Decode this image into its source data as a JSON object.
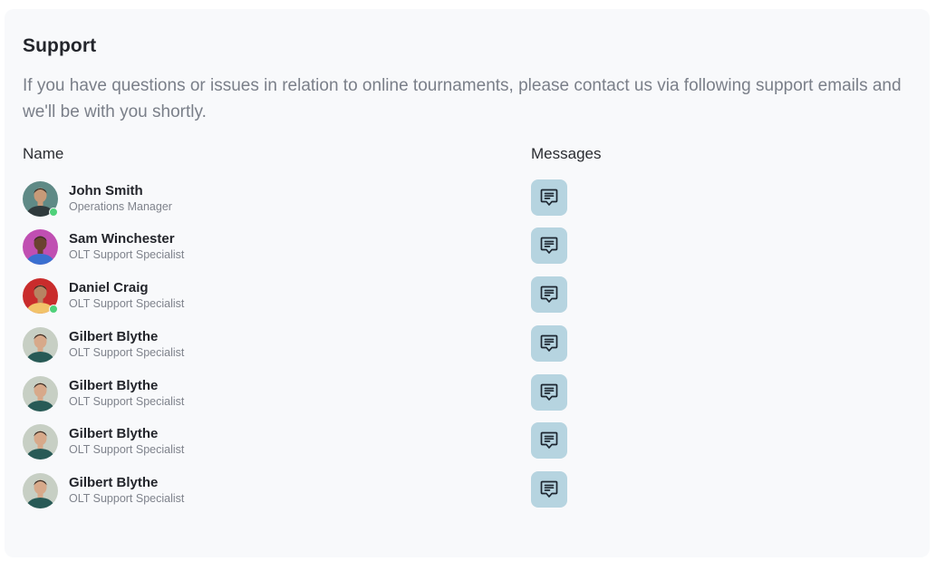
{
  "support": {
    "title": "Support",
    "description": "If you have questions or issues in relation to online tournaments, please contact us via following support emails and we'll be with you shortly.",
    "columns": {
      "name": "Name",
      "messages": "Messages"
    },
    "contacts": [
      {
        "name": "John Smith",
        "role": "Operations Manager",
        "online": true,
        "avatar_bg": "#5f8a86",
        "avatar_skin": "#c79a78",
        "avatar_shirt": "#2f3a3c"
      },
      {
        "name": "Sam Winchester",
        "role": "OLT Support Specialist",
        "online": false,
        "avatar_bg": "#c04fb2",
        "avatar_skin": "#6a4230",
        "avatar_shirt": "#3a6fd0"
      },
      {
        "name": "Daniel Craig",
        "role": "OLT Support Specialist",
        "online": true,
        "avatar_bg": "#c92c2c",
        "avatar_skin": "#b78462",
        "avatar_shirt": "#f2c36a"
      },
      {
        "name": "Gilbert Blythe",
        "role": "OLT Support Specialist",
        "online": false,
        "avatar_bg": "#c7cfc4",
        "avatar_skin": "#d7a98a",
        "avatar_shirt": "#285a56"
      },
      {
        "name": "Gilbert Blythe",
        "role": "OLT Support Specialist",
        "online": false,
        "avatar_bg": "#c7cfc4",
        "avatar_skin": "#d7a98a",
        "avatar_shirt": "#285a56"
      },
      {
        "name": "Gilbert Blythe",
        "role": "OLT Support Specialist",
        "online": false,
        "avatar_bg": "#c7cfc4",
        "avatar_skin": "#d7a98a",
        "avatar_shirt": "#285a56"
      },
      {
        "name": "Gilbert Blythe",
        "role": "OLT Support Specialist",
        "online": false,
        "avatar_bg": "#c7cfc4",
        "avatar_skin": "#d7a98a",
        "avatar_shirt": "#285a56"
      }
    ],
    "message_icon": "message-icon",
    "colors": {
      "card_bg": "#f8f9fb",
      "button_bg": "#b6d4e0",
      "online_dot": "#4fd17a"
    }
  }
}
